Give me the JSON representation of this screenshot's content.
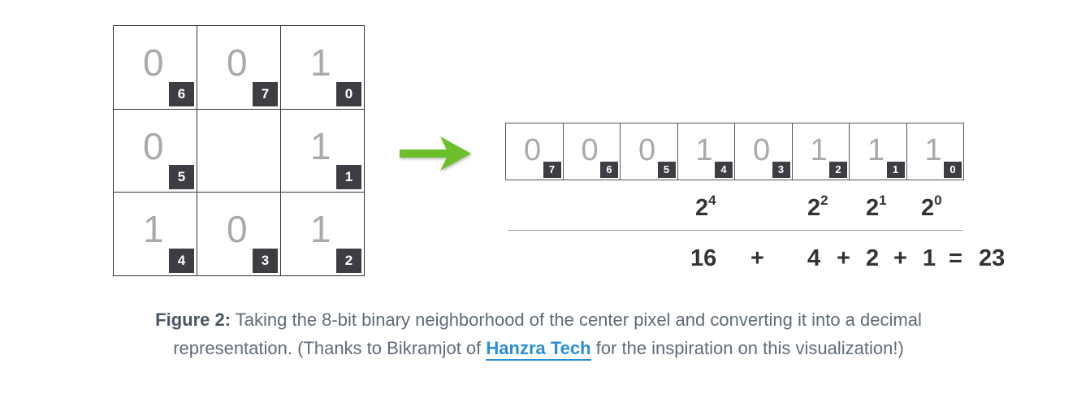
{
  "grid": {
    "cells": [
      {
        "bit": "0",
        "index": "6"
      },
      {
        "bit": "0",
        "index": "7"
      },
      {
        "bit": "1",
        "index": "0"
      },
      {
        "bit": "0",
        "index": "5"
      },
      {
        "bit": "",
        "index": ""
      },
      {
        "bit": "1",
        "index": "1"
      },
      {
        "bit": "1",
        "index": "4"
      },
      {
        "bit": "0",
        "index": "3"
      },
      {
        "bit": "1",
        "index": "2"
      }
    ]
  },
  "binary_row": [
    {
      "bit": "0",
      "index": "7"
    },
    {
      "bit": "0",
      "index": "6"
    },
    {
      "bit": "0",
      "index": "5"
    },
    {
      "bit": "1",
      "index": "4"
    },
    {
      "bit": "0",
      "index": "3"
    },
    {
      "bit": "1",
      "index": "2"
    },
    {
      "bit": "1",
      "index": "1"
    },
    {
      "bit": "1",
      "index": "0"
    }
  ],
  "powers": [
    {
      "base": "2",
      "exp": "4"
    },
    {
      "base": "2",
      "exp": "2"
    },
    {
      "base": "2",
      "exp": "1"
    },
    {
      "base": "2",
      "exp": "0"
    }
  ],
  "sum": {
    "terms": [
      "16",
      "+",
      "4",
      "+",
      "2",
      "+",
      "1",
      "=",
      "23"
    ]
  },
  "caption": {
    "label": "Figure 2:",
    "text_before": " Taking the 8-bit binary neighborhood of the center pixel and converting it into a decimal representation. (Thanks to Bikramjot of ",
    "link_text": "Hanzra Tech",
    "text_after": " for the inspiration on this visualization!)"
  },
  "colors": {
    "arrow": "#6cbf2a",
    "link": "#2a8fd6",
    "index_badge": "#3d3d44",
    "bit_text": "#a9a9a9"
  }
}
